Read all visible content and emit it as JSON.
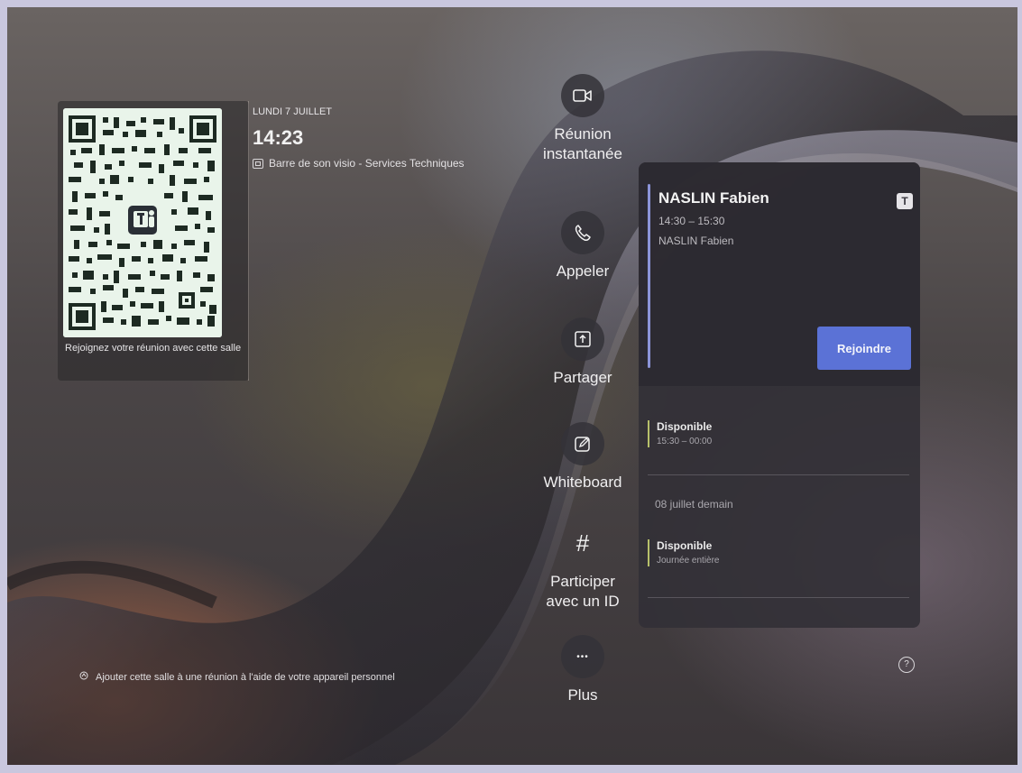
{
  "header": {
    "date": "LUNDI 7 JUILLET",
    "time": "14:23",
    "room_name": "Barre de son visio - Services Techniques",
    "room_icon": "display-icon"
  },
  "qr": {
    "caption": "Rejoignez votre réunion avec cette salle",
    "center_logo": "T"
  },
  "actions": [
    {
      "label": "Réunion instantanée",
      "icon": "video-camera-icon"
    },
    {
      "label": "Appeler",
      "icon": "phone-icon"
    },
    {
      "label": "Partager",
      "icon": "share-upload-icon"
    },
    {
      "label": "Whiteboard",
      "icon": "whiteboard-pen-icon"
    },
    {
      "label": "Participer avec un ID",
      "icon": "hash-icon",
      "glyph": "#"
    },
    {
      "label": "Plus",
      "icon": "more-icon",
      "glyph": "•••"
    }
  ],
  "meeting": {
    "title": "NASLIN Fabien",
    "time": "14:30 – 15:30",
    "organizer": "NASLIN Fabien",
    "join_label": "Rejoindre",
    "teams_badge": "T"
  },
  "schedule": {
    "today_slot": {
      "status": "Disponible",
      "time": "15:30 – 00:00"
    },
    "tomorrow_label": "08 juillet demain",
    "tomorrow_slot": {
      "status": "Disponible",
      "time": "Journée entière"
    }
  },
  "footer": {
    "note": "Ajouter cette salle à une réunion à l'aide de votre appareil personnel",
    "help_glyph": "?"
  },
  "colors": {
    "accent": "#5b72d6",
    "meeting_bar": "#8c94d8",
    "available_bar": "#b7c06a"
  }
}
